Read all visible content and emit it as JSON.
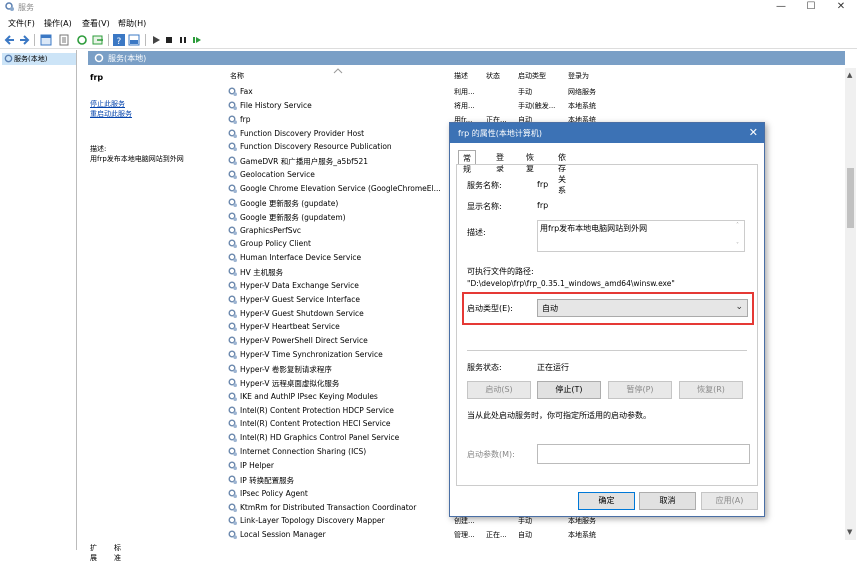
{
  "window": {
    "title": "服务"
  },
  "menu": [
    "文件(F)",
    "操作(A)",
    "查看(V)",
    "帮助(H)"
  ],
  "nav": {
    "node": "服务(本地)"
  },
  "pane": {
    "header": "服务(本地)"
  },
  "detail": {
    "name": "frp",
    "stop_link": "停止此服务",
    "restart_link": "重启动此服务",
    "desc_label": "描述:",
    "desc_text": "用frp发布本地电脑网站到外网"
  },
  "columns": {
    "name": "名称",
    "desc": "描述",
    "status": "状态",
    "start": "启动类型",
    "logon": "登录为"
  },
  "services": [
    {
      "name": "Fax",
      "desc": "利用...",
      "status": "",
      "start": "手动",
      "logon": "网络服务"
    },
    {
      "name": "File History Service",
      "desc": "将用...",
      "status": "",
      "start": "手动(触发...",
      "logon": "本地系统"
    },
    {
      "name": "frp",
      "desc": "用fr...",
      "status": "正在...",
      "start": "自动",
      "logon": "本地系统"
    },
    {
      "name": "Function Discovery Provider Host",
      "desc": "",
      "status": "",
      "start": "",
      "logon": ""
    },
    {
      "name": "Function Discovery Resource Publication",
      "desc": "",
      "status": "",
      "start": "",
      "logon": ""
    },
    {
      "name": "GameDVR 和广播用户服务_a5bf521",
      "desc": "",
      "status": "",
      "start": "",
      "logon": ""
    },
    {
      "name": "Geolocation Service",
      "desc": "",
      "status": "",
      "start": "",
      "logon": ""
    },
    {
      "name": "Google Chrome Elevation Service (GoogleChromeEl...",
      "desc": "",
      "status": "",
      "start": "",
      "logon": ""
    },
    {
      "name": "Google 更新服务 (gupdate)",
      "desc": "",
      "status": "",
      "start": "",
      "logon": ""
    },
    {
      "name": "Google 更新服务 (gupdatem)",
      "desc": "",
      "status": "",
      "start": "",
      "logon": ""
    },
    {
      "name": "GraphicsPerfSvc",
      "desc": "",
      "status": "",
      "start": "",
      "logon": ""
    },
    {
      "name": "Group Policy Client",
      "desc": "",
      "status": "",
      "start": "",
      "logon": ""
    },
    {
      "name": "Human Interface Device Service",
      "desc": "",
      "status": "",
      "start": "",
      "logon": ""
    },
    {
      "name": "HV 主机服务",
      "desc": "",
      "status": "",
      "start": "",
      "logon": ""
    },
    {
      "name": "Hyper-V Data Exchange Service",
      "desc": "",
      "status": "",
      "start": "",
      "logon": ""
    },
    {
      "name": "Hyper-V Guest Service Interface",
      "desc": "",
      "status": "",
      "start": "",
      "logon": ""
    },
    {
      "name": "Hyper-V Guest Shutdown Service",
      "desc": "",
      "status": "",
      "start": "",
      "logon": ""
    },
    {
      "name": "Hyper-V Heartbeat Service",
      "desc": "",
      "status": "",
      "start": "",
      "logon": ""
    },
    {
      "name": "Hyper-V PowerShell Direct Service",
      "desc": "",
      "status": "",
      "start": "",
      "logon": ""
    },
    {
      "name": "Hyper-V Time Synchronization Service",
      "desc": "",
      "status": "",
      "start": "",
      "logon": ""
    },
    {
      "name": "Hyper-V 卷影复制请求程序",
      "desc": "",
      "status": "",
      "start": "",
      "logon": ""
    },
    {
      "name": "Hyper-V 远程桌面虚拟化服务",
      "desc": "",
      "status": "",
      "start": "",
      "logon": ""
    },
    {
      "name": "IKE and AuthIP IPsec Keying Modules",
      "desc": "",
      "status": "",
      "start": "",
      "logon": ""
    },
    {
      "name": "Intel(R) Content Protection HDCP Service",
      "desc": "",
      "status": "",
      "start": "",
      "logon": ""
    },
    {
      "name": "Intel(R) Content Protection HECI Service",
      "desc": "",
      "status": "",
      "start": "",
      "logon": ""
    },
    {
      "name": "Intel(R) HD Graphics Control Panel Service",
      "desc": "",
      "status": "",
      "start": "",
      "logon": ""
    },
    {
      "name": "Internet Connection Sharing (ICS)",
      "desc": "",
      "status": "",
      "start": "",
      "logon": ""
    },
    {
      "name": "IP Helper",
      "desc": "",
      "status": "",
      "start": "",
      "logon": ""
    },
    {
      "name": "IP 转换配置服务",
      "desc": "",
      "status": "",
      "start": "",
      "logon": ""
    },
    {
      "name": "IPsec Policy Agent",
      "desc": "",
      "status": "",
      "start": "",
      "logon": ""
    },
    {
      "name": "KtmRm for Distributed Transaction Coordinator",
      "desc": "",
      "status": "",
      "start": "",
      "logon": ""
    },
    {
      "name": "Link-Layer Topology Discovery Mapper",
      "desc": "创建...",
      "status": "",
      "start": "手动",
      "logon": "本地服务"
    },
    {
      "name": "Local Session Manager",
      "desc": "管理...",
      "status": "正在...",
      "start": "自动",
      "logon": "本地系统"
    }
  ],
  "tabs": [
    "扩展",
    "标准"
  ],
  "dialog": {
    "title": "frp 的属性(本地计算机)",
    "tabs": [
      "常规",
      "登录",
      "恢复",
      "依存关系"
    ],
    "service_name_label": "服务名称:",
    "service_name": "frp",
    "display_name_label": "显示名称:",
    "display_name": "frp",
    "desc_label": "描述:",
    "desc": "用frp发布本地电脑网站到外网",
    "path_label": "可执行文件的路径:",
    "path": "\"D:\\develop\\frp\\frp_0.35.1_windows_amd64\\winsw.exe\"",
    "startup_label": "启动类型(E):",
    "startup_value": "自动",
    "status_label": "服务状态:",
    "status_value": "正在运行",
    "btn_start": "启动(S)",
    "btn_stop": "停止(T)",
    "btn_pause": "暂停(P)",
    "btn_resume": "恢复(R)",
    "hint": "当从此处启动服务时，你可指定所适用的启动参数。",
    "param_label": "启动参数(M):",
    "param_value": "",
    "btn_ok": "确定",
    "btn_cancel": "取消",
    "btn_apply": "应用(A)"
  }
}
